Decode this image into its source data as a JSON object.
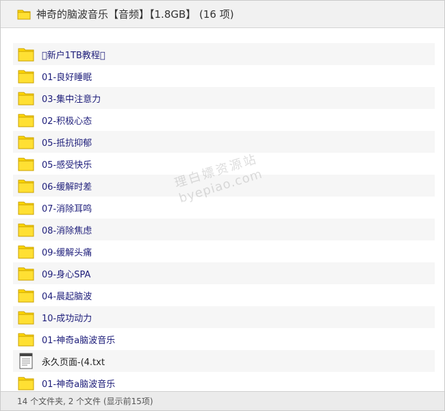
{
  "window": {
    "title": "神奇的脑波音乐【音频】【1.8GB】 (16 项)"
  },
  "items": [
    {
      "type": "folder",
      "name": "\u0000新户1TB教程\u0000"
    },
    {
      "type": "folder",
      "name": "01-良好睡眠"
    },
    {
      "type": "folder",
      "name": "03-集中注意力"
    },
    {
      "type": "folder",
      "name": "02-积极心态"
    },
    {
      "type": "folder",
      "name": "05-抵抗抑郁"
    },
    {
      "type": "folder",
      "name": "05-感受快乐"
    },
    {
      "type": "folder",
      "name": "06-缓解时差"
    },
    {
      "type": "folder",
      "name": "07-消除耳鸣"
    },
    {
      "type": "folder",
      "name": "08-消除焦虑"
    },
    {
      "type": "folder",
      "name": "09-缓解头痛"
    },
    {
      "type": "folder",
      "name": "09-身心SPA"
    },
    {
      "type": "folder",
      "name": "04-晨起脑波"
    },
    {
      "type": "folder",
      "name": "10-成功动力"
    },
    {
      "type": "folder",
      "name": "01-神奇a脑波音乐"
    },
    {
      "type": "file",
      "name": "永久页面-(4.txt"
    },
    {
      "type": "folder",
      "name": "01-神奇a脑波音乐"
    }
  ],
  "watermark": {
    "line1": "理白嫖资源站",
    "line2": "byepiao.com"
  },
  "status": {
    "text": "14 个文件夹, 2 个文件 (显示前15项)"
  },
  "colors": {
    "folder": "#FFD700",
    "folder_border": "#C9A100",
    "link_text": "#1D1D7A"
  }
}
